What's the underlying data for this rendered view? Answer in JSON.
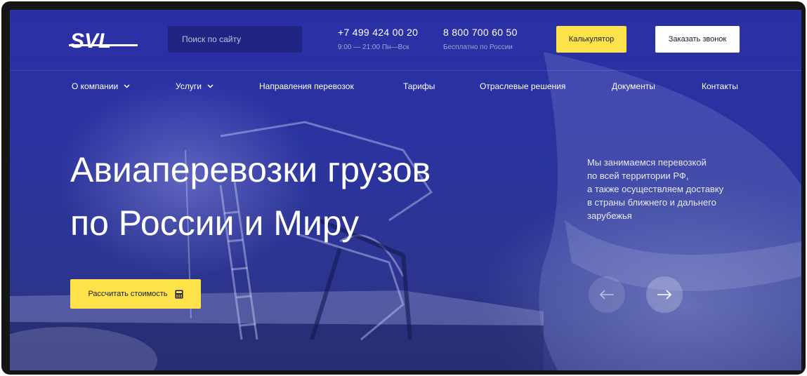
{
  "brand": {
    "logo_text": "SVL"
  },
  "header": {
    "search_placeholder": "Поиск по сайту",
    "phone1": {
      "number": "+7 499 424 00 20",
      "hours": "9:00 — 21:00 Пн—Вск"
    },
    "phone2": {
      "number": "8 800 700 60 50",
      "note": "Бесплатно по России"
    },
    "calc_button": "Калькулятор",
    "call_button": "Заказать звонок"
  },
  "nav": {
    "items": [
      {
        "label": "О компании",
        "has_dropdown": true
      },
      {
        "label": "Услуги",
        "has_dropdown": true
      },
      {
        "label": "Направления перевозок",
        "has_dropdown": false
      },
      {
        "label": "Тарифы",
        "has_dropdown": false
      },
      {
        "label": "Отраслевые решения",
        "has_dropdown": false
      },
      {
        "label": "Документы",
        "has_dropdown": false
      },
      {
        "label": "Контакты",
        "has_dropdown": false
      }
    ]
  },
  "hero": {
    "title_line1": "Авиаперевозки грузов",
    "title_line2": "по России и Миру",
    "desc_lines": [
      "Мы занимаемся перевозкой",
      "по всей территории РФ,",
      "а также осуществляем доставку",
      "в страны ближнего и дальнего",
      "зарубежья"
    ],
    "cta_button": "Рассчитать стоимость"
  },
  "slider": {
    "prev_icon": "arrow-left-icon",
    "next_icon": "arrow-right-icon"
  },
  "colors": {
    "accent_yellow": "#fde24a",
    "hero_blue": "#2b2fa6",
    "white": "#ffffff"
  }
}
